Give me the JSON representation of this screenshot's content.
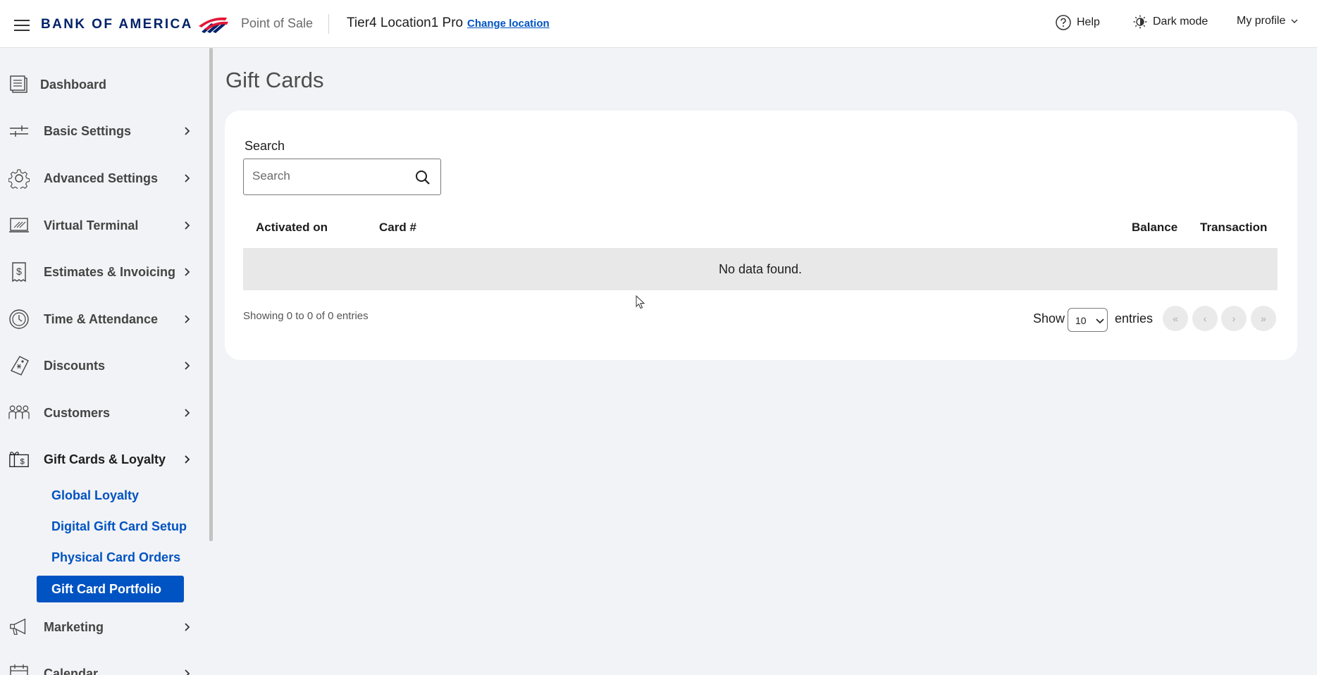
{
  "header": {
    "logo_text": "BANK OF AMERICA",
    "app_name": "Point of Sale",
    "location": "Tier4 Location1 Pro",
    "change_location": "Change location",
    "help": "Help",
    "dark_mode": "Dark mode",
    "profile": "My profile"
  },
  "sidebar": {
    "items": [
      {
        "label": "Dashboard",
        "icon": "dashboard-icon"
      },
      {
        "label": "Basic Settings",
        "icon": "sliders-icon"
      },
      {
        "label": "Advanced Settings",
        "icon": "gear-icon"
      },
      {
        "label": "Virtual Terminal",
        "icon": "terminal-icon"
      },
      {
        "label": "Estimates & Invoicing",
        "icon": "invoice-icon"
      },
      {
        "label": "Time & Attendance",
        "icon": "clock-icon"
      },
      {
        "label": "Discounts",
        "icon": "tag-icon"
      },
      {
        "label": "Customers",
        "icon": "people-icon"
      },
      {
        "label": "Gift Cards & Loyalty",
        "icon": "gift-card-icon"
      },
      {
        "label": "Marketing",
        "icon": "megaphone-icon"
      },
      {
        "label": "Calendar",
        "icon": "calendar-icon"
      }
    ],
    "sub_items": [
      "Global Loyalty",
      "Digital Gift Card Setup",
      "Physical Card Orders",
      "Gift Card Portfolio"
    ]
  },
  "main": {
    "title": "Gift Cards",
    "search_label": "Search",
    "search_placeholder": "Search",
    "columns": [
      "Activated on",
      "Card #",
      "Balance",
      "Transaction"
    ],
    "empty_message": "No data found.",
    "showing": "Showing 0 to 0 of 0 entries",
    "show_label": "Show",
    "page_size": "10",
    "entries_label": "entries",
    "pager": {
      "first": "«",
      "prev": "‹",
      "next": "›",
      "last": "»"
    }
  },
  "colors": {
    "brand_blue": "#0053c2",
    "logo_navy": "#012169",
    "logo_red": "#e31837"
  }
}
